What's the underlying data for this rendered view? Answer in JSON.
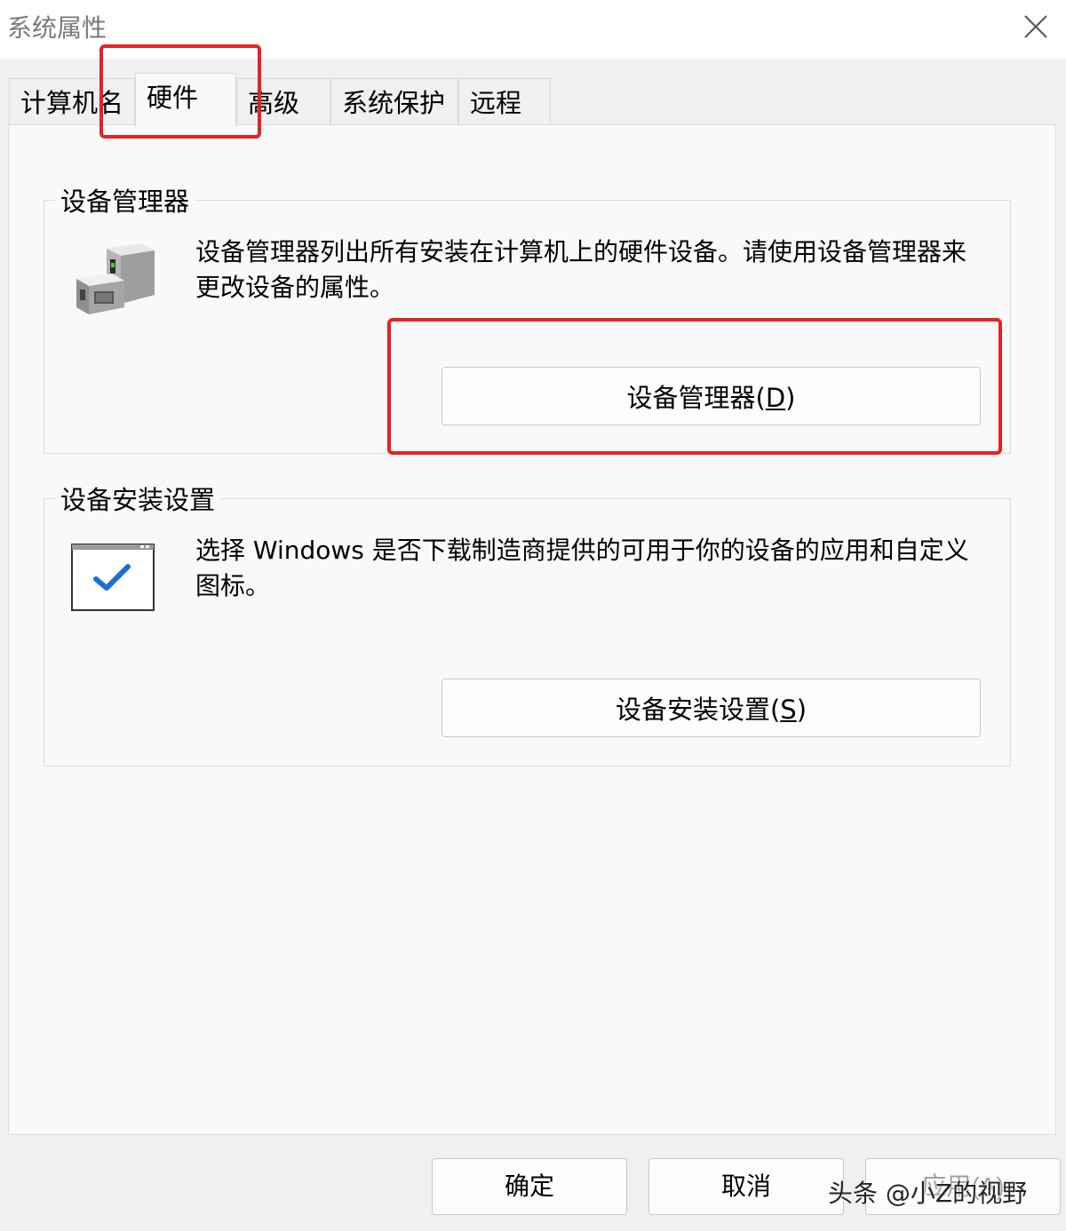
{
  "window": {
    "title": "系统属性",
    "close_icon": "close-icon"
  },
  "tabs": [
    {
      "label": "计算机名",
      "active": false
    },
    {
      "label": "硬件",
      "active": true
    },
    {
      "label": "高级",
      "active": false
    },
    {
      "label": "系统保护",
      "active": false
    },
    {
      "label": "远程",
      "active": false
    }
  ],
  "device_manager": {
    "group_title": "设备管理器",
    "icon": "device-manager-icon",
    "description": "设备管理器列出所有安装在计算机上的硬件设备。请使用设备管理器来更改设备的属性。",
    "button_label": "设备管理器(",
    "button_accel": "D",
    "button_suffix": ")"
  },
  "device_install": {
    "group_title": "设备安装设置",
    "icon": "checkmark-window-icon",
    "description": "选择 Windows 是否下载制造商提供的可用于你的设备的应用和自定义图标。",
    "button_label": "设备安装设置(",
    "button_accel": "S",
    "button_suffix": ")"
  },
  "footer": {
    "ok_label": "确定",
    "cancel_label": "取消",
    "apply_label": "应用(A)"
  },
  "watermark": "头条 @小Z的视野",
  "colors": {
    "highlight": "#e52222",
    "check": "#1b6fd6"
  }
}
